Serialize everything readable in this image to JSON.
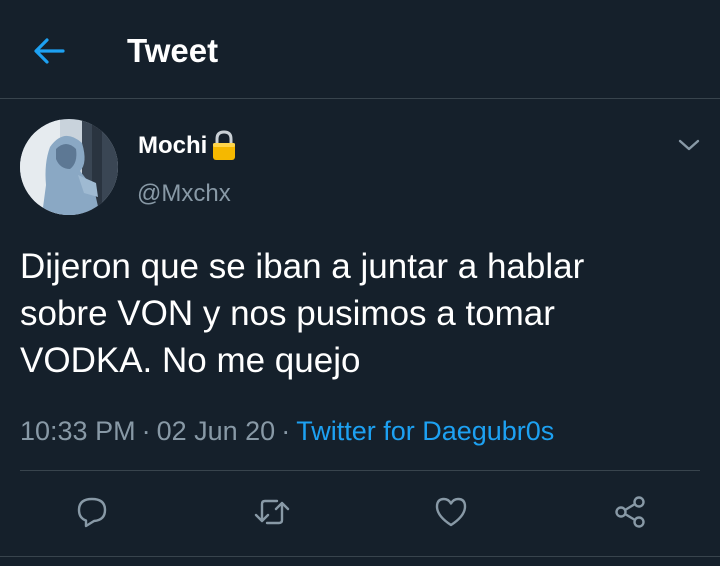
{
  "header": {
    "title": "Tweet",
    "back_icon": "arrow-left-icon"
  },
  "tweet": {
    "author": {
      "display_name": "Mochi",
      "handle": "@Mxchx",
      "lock_icon": "lock-icon"
    },
    "text_lines": [
      "Dijeron que se iban a juntar a hablar",
      "sobre VON y nos pusimos a tomar",
      "VODKA. No me quejo"
    ],
    "time": "10:33 PM",
    "date": "02 Jun 20",
    "separator": "·",
    "source": "Twitter for Daegubr0s"
  },
  "actions": [
    "reply-icon",
    "retweet-icon",
    "like-icon",
    "share-icon"
  ],
  "colors": {
    "background": "#15202b",
    "accent": "#1da1f2",
    "secondary_text": "#8899a6",
    "divider": "#38444d",
    "lock": "#f5b800"
  }
}
